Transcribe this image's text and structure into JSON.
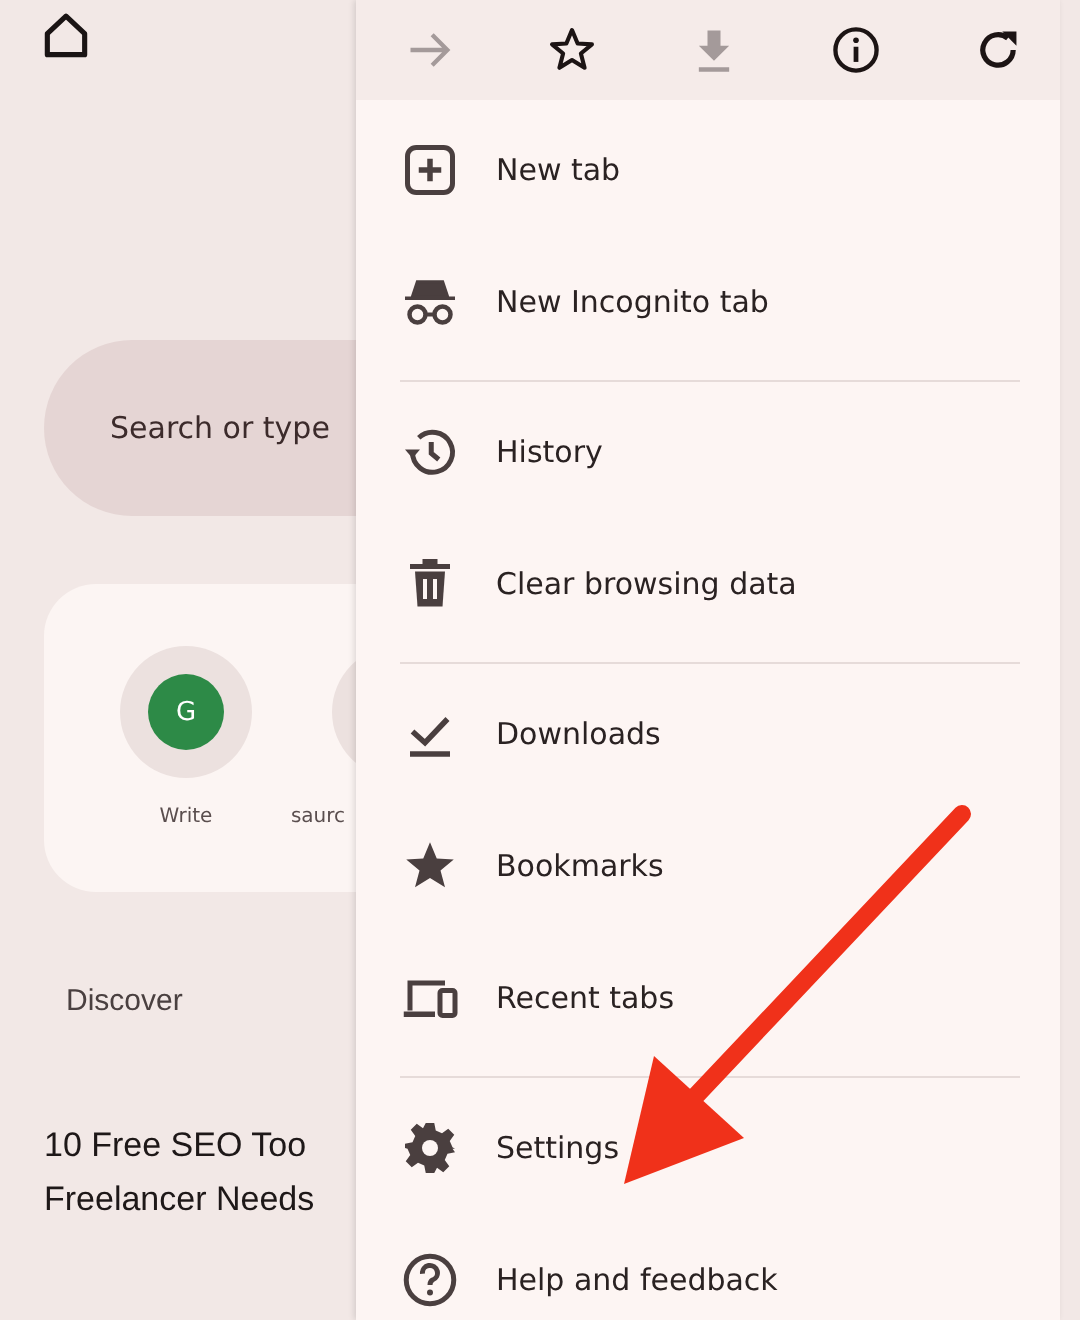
{
  "page": {
    "search": {
      "placeholder": "Search or type"
    },
    "shortcuts": [
      {
        "label": "Write",
        "letter": "G"
      },
      {
        "label": "saurc"
      }
    ],
    "discover": {
      "label": "Discover"
    },
    "headline_lines": [
      "10 Free SEO Too",
      "Freelancer Needs"
    ]
  },
  "menu": {
    "toolbar": [
      {
        "disabled": true
      },
      {
        "disabled": false
      },
      {
        "disabled": true
      },
      {
        "disabled": false
      },
      {
        "disabled": false
      }
    ],
    "groups": [
      [
        {
          "label": "New tab"
        },
        {
          "label": "New Incognito tab"
        }
      ],
      [
        {
          "label": "History"
        },
        {
          "label": "Clear browsing data"
        }
      ],
      [
        {
          "label": "Downloads"
        },
        {
          "label": "Bookmarks"
        },
        {
          "label": "Recent tabs"
        }
      ],
      [
        {
          "label": "Settings"
        },
        {
          "label": "Help and feedback"
        }
      ]
    ]
  }
}
